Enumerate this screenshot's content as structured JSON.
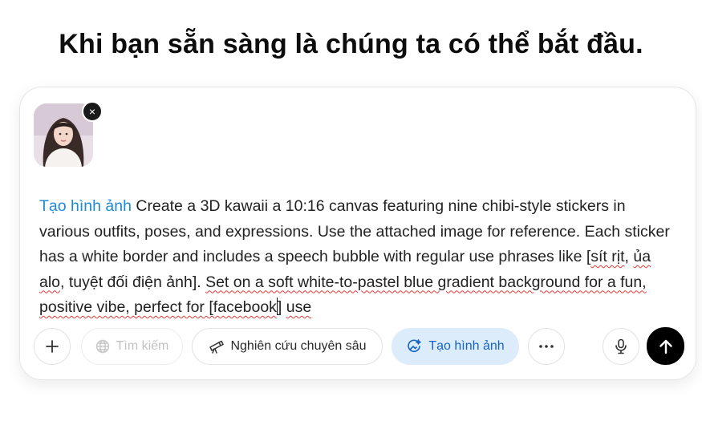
{
  "heading": "Khi bạn sẵn sàng là chúng ta có thể bắt đầu.",
  "attachment": {
    "close_glyph": "×"
  },
  "prompt": {
    "chip": "Tạo hình ảnh",
    "text_1": " Create a 3D kawaii a 10:16 canvas featuring nine chibi-style stickers in various outfits, poses, and expressions. Use the attached image for reference. Each sticker has a white border and includes a speech bubble with regular use phrases like [",
    "spell_1": "sít rịt",
    "text_2": ", ",
    "spell_2": "ủa alo",
    "text_3": ", tuyệt đối điện ảnh]. ",
    "spell_3": "Set on a soft white-to-pastel blue gradient background for a fun, positive vibe, perfect for [facebook",
    "text_4": "] ",
    "spell_4": "use"
  },
  "toolbar": {
    "add_label": "+",
    "search_label": "Tìm kiếm",
    "research_label": "Nghiên cứu chuyên sâu",
    "image_label": "Tạo hình ảnh",
    "more_label": "•••"
  },
  "icons": {
    "add": "plus-icon",
    "search": "globe-icon",
    "research": "telescope-icon",
    "image": "image-sparkle-icon",
    "more": "more-icon",
    "mic": "microphone-icon",
    "send": "arrow-up-icon"
  },
  "colors": {
    "accent": "#1d8ad6",
    "active_bg": "#dcecfb",
    "send_bg": "#000000",
    "spell_underline": "#e53935"
  }
}
